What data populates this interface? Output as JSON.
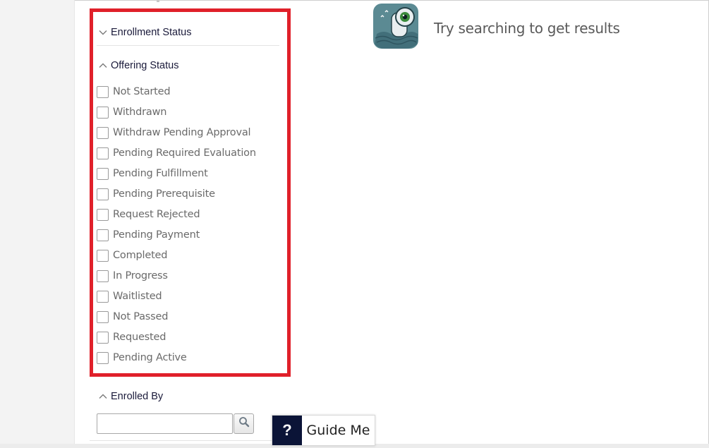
{
  "filters": {
    "enrollment_status": {
      "label": "Enrollment Status",
      "state": "collapsed"
    },
    "offering_status": {
      "label": "Offering Status",
      "state": "expanded",
      "options": [
        {
          "label": "Not Started",
          "checked": false
        },
        {
          "label": "Withdrawn",
          "checked": false
        },
        {
          "label": "Withdraw Pending Approval",
          "checked": false
        },
        {
          "label": "Pending Required Evaluation",
          "checked": false
        },
        {
          "label": "Pending Fulfillment",
          "checked": false
        },
        {
          "label": "Pending Prerequisite",
          "checked": false
        },
        {
          "label": "Request Rejected",
          "checked": false
        },
        {
          "label": "Pending Payment",
          "checked": false
        },
        {
          "label": "Completed",
          "checked": false
        },
        {
          "label": "In Progress",
          "checked": false
        },
        {
          "label": "Waitlisted",
          "checked": false
        },
        {
          "label": "Not Passed",
          "checked": false
        },
        {
          "label": "Requested",
          "checked": false
        },
        {
          "label": "Pending Active",
          "checked": false
        }
      ]
    },
    "enrolled_by": {
      "label": "Enrolled By",
      "state": "expanded",
      "input_value": "",
      "search_icon": "magnifier-icon"
    }
  },
  "results": {
    "empty_message": "Try searching to get results",
    "icon": "binoculars-icon"
  },
  "guide_me": {
    "symbol": "?",
    "label": "Guide Me"
  },
  "colors": {
    "highlight_border": "#e0202a",
    "header_text": "#1a1a3a",
    "option_text": "#6a6a6a",
    "guide_me_bg": "#0b1437",
    "icon_teal": "#5b8a93"
  }
}
